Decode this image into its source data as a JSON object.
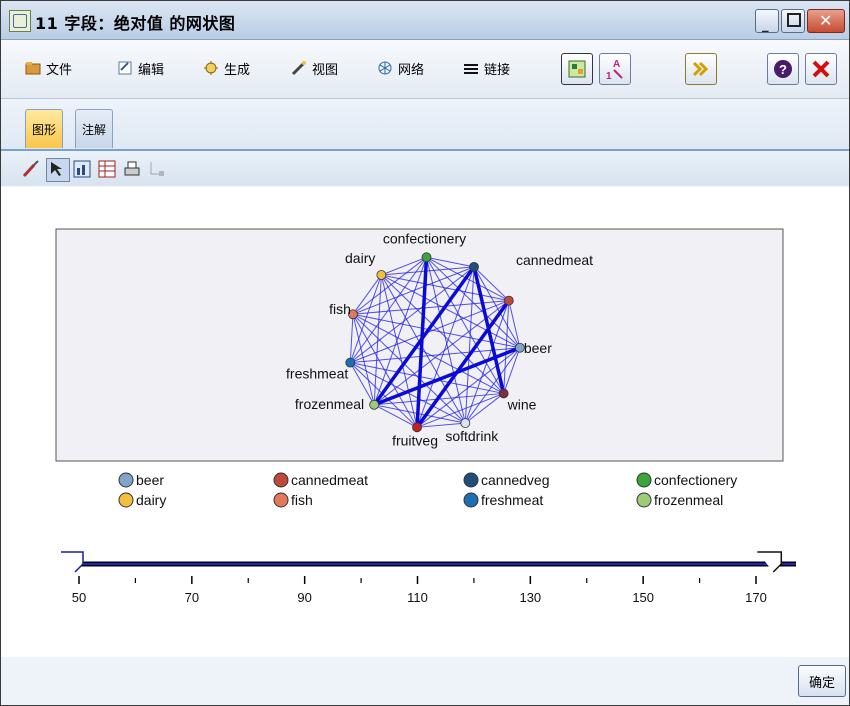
{
  "window": {
    "title": "11 字段：绝对值 的网状图"
  },
  "menu": [
    {
      "id": "file",
      "label": "文件",
      "icon": "folder-icon"
    },
    {
      "id": "edit",
      "label": "编辑",
      "icon": "edit-icon"
    },
    {
      "id": "generate",
      "label": "生成",
      "icon": "generate-icon"
    },
    {
      "id": "view",
      "label": "视图",
      "icon": "view-icon"
    },
    {
      "id": "network",
      "label": "网络",
      "icon": "network-icon"
    },
    {
      "id": "links",
      "label": "链接",
      "icon": "links-icon"
    }
  ],
  "tabs": [
    {
      "label": "图形",
      "active": true
    },
    {
      "label": "注解",
      "active": false
    }
  ],
  "graph": {
    "nodes": [
      {
        "name": "confectionery",
        "color": "#3aa63a"
      },
      {
        "name": "cannedveg",
        "color": "#1f4e79"
      },
      {
        "name": "cannedmeat",
        "color": "#c04a3a"
      },
      {
        "name": "beer",
        "color": "#7fa6c8"
      },
      {
        "name": "wine",
        "color": "#7a2f3a"
      },
      {
        "name": "softdrink",
        "color": "#d8e6f0"
      },
      {
        "name": "fruitveg",
        "color": "#c82020"
      },
      {
        "name": "frozenmeal",
        "color": "#9ccc78"
      },
      {
        "name": "freshmeat",
        "color": "#1d6fb5"
      },
      {
        "name": "fish",
        "color": "#e07a5a"
      },
      {
        "name": "dairy",
        "color": "#f2c040"
      }
    ],
    "label_overrides": {
      "cannedveg": ""
    }
  },
  "legend": [
    {
      "name": "beer",
      "color": "#7fa6c8"
    },
    {
      "name": "cannedmeat",
      "color": "#c04a3a"
    },
    {
      "name": "cannedveg",
      "color": "#1f4e79"
    },
    {
      "name": "confectionery",
      "color": "#3aa63a"
    },
    {
      "name": "dairy",
      "color": "#f2c040"
    },
    {
      "name": "fish",
      "color": "#e07a5a"
    },
    {
      "name": "freshmeat",
      "color": "#1d6fb5"
    },
    {
      "name": "frozenmeal",
      "color": "#9ccc78"
    }
  ],
  "slider": {
    "ticks": [
      "50",
      "70",
      "90",
      "110",
      "130",
      "150",
      "170"
    ],
    "min": 50,
    "max": 170,
    "low": 50,
    "high": 172
  },
  "buttons": {
    "ok": "确定"
  }
}
